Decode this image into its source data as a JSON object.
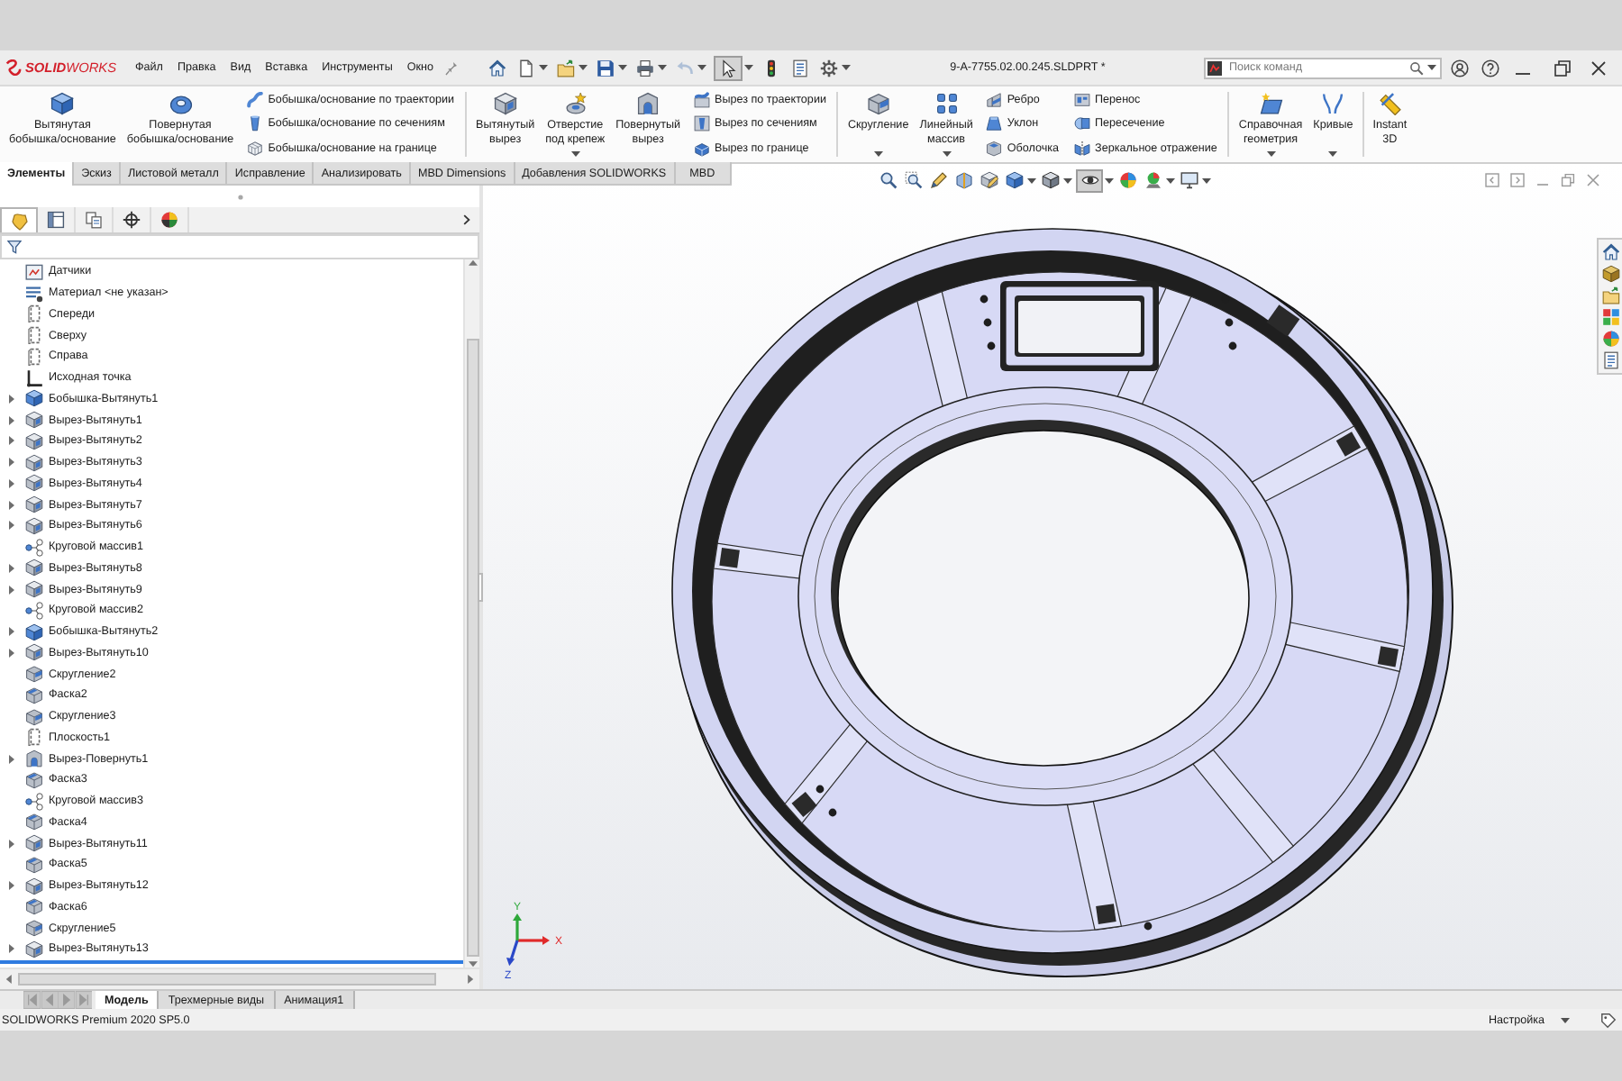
{
  "window": {
    "logo": "**SOLID**WORKS",
    "title": "9-A-7755.02.00.245.SLDPRT *"
  },
  "menu": [
    "Файл",
    "Правка",
    "Вид",
    "Вставка",
    "Инструменты",
    "Окно"
  ],
  "quick_access": [
    {
      "dropdown": false,
      "disabled": false,
      "pressed": false
    },
    {
      "dropdown": true,
      "disabled": false,
      "pressed": false
    },
    {
      "dropdown": true,
      "disabled": false,
      "pressed": false
    },
    {
      "dropdown": true,
      "disabled": false,
      "pressed": false
    },
    {
      "dropdown": true,
      "disabled": false,
      "pressed": false
    },
    {
      "dropdown": true,
      "disabled": true,
      "pressed": false
    },
    {
      "dropdown": true,
      "disabled": false,
      "pressed": true
    },
    {
      "dropdown": false,
      "disabled": false,
      "pressed": false
    },
    {
      "dropdown": false,
      "disabled": false,
      "pressed": false
    },
    {
      "dropdown": true,
      "disabled": false,
      "pressed": false
    }
  ],
  "search": {
    "placeholder": "Поиск команд"
  },
  "ribbon": {
    "groups": [
      [
        {
          "kind": "large",
          "label": "Вытянутая\nбобышка/основание",
          "dropdown": false
        },
        {
          "kind": "large",
          "label": "Повернутая\nбобышка/основание",
          "dropdown": false
        },
        {
          "kind": "stack",
          "items": [
            "Бобышка/основание по траектории",
            "Бобышка/основание по сечениям",
            "Бобышка/основание на границе"
          ]
        }
      ],
      [
        {
          "kind": "large",
          "label": "Вытянутый\nвырез",
          "dropdown": false
        },
        {
          "kind": "large",
          "label": "Отверстие\nпод крепеж",
          "dropdown": true
        },
        {
          "kind": "large",
          "label": "Повернутый\nвырез",
          "dropdown": false
        },
        {
          "kind": "stack",
          "items": [
            "Вырез по траектории",
            "Вырез по сечениям",
            "Вырез по границе"
          ]
        }
      ],
      [
        {
          "kind": "large",
          "label": "Скругление",
          "dropdown": true
        },
        {
          "kind": "large",
          "label": "Линейный\nмассив",
          "dropdown": true
        },
        {
          "kind": "stack",
          "items": [
            "Ребро",
            "Уклон",
            "Оболочка"
          ]
        },
        {
          "kind": "stack",
          "items": [
            "Перенос",
            "Пересечение",
            "Зеркальное отражение"
          ]
        }
      ],
      [
        {
          "kind": "large",
          "label": "Справочная\nгеометрия",
          "dropdown": true
        },
        {
          "kind": "large",
          "label": "Кривые",
          "dropdown": true
        }
      ],
      [
        {
          "kind": "large",
          "label": "Instant\n3D",
          "dropdown": false
        }
      ]
    ]
  },
  "command_tabs": [
    {
      "label": "Элементы",
      "selected": true
    },
    {
      "label": "Эскиз",
      "selected": false
    },
    {
      "label": "Листовой металл",
      "selected": false
    },
    {
      "label": "Исправление",
      "selected": false
    },
    {
      "label": "Анализировать",
      "selected": false
    },
    {
      "label": "MBD Dimensions",
      "selected": false
    },
    {
      "label": "Добавления SOLIDWORKS",
      "selected": false
    },
    {
      "label": "MBD",
      "selected": false
    }
  ],
  "panel_tabs": [
    {
      "selected": true
    },
    {
      "selected": false
    },
    {
      "selected": false
    },
    {
      "selected": false
    },
    {
      "selected": false
    }
  ],
  "feature_tree": {
    "items": [
      {
        "kind": "sensors",
        "label": "Датчики",
        "expandable": false
      },
      {
        "kind": "material",
        "label": "Материал <не указан>",
        "expandable": false
      },
      {
        "kind": "plane",
        "label": "Спереди",
        "expandable": false
      },
      {
        "kind": "plane",
        "label": "Сверху",
        "expandable": false
      },
      {
        "kind": "plane",
        "label": "Справа",
        "expandable": false
      },
      {
        "kind": "origin",
        "label": "Исходная точка",
        "expandable": false
      },
      {
        "kind": "boss",
        "label": "Бобышка-Вытянуть1",
        "expandable": true
      },
      {
        "kind": "cut",
        "label": "Вырез-Вытянуть1",
        "expandable": true
      },
      {
        "kind": "cut",
        "label": "Вырез-Вытянуть2",
        "expandable": true
      },
      {
        "kind": "cut",
        "label": "Вырез-Вытянуть3",
        "expandable": true
      },
      {
        "kind": "cut",
        "label": "Вырез-Вытянуть4",
        "expandable": true
      },
      {
        "kind": "cut",
        "label": "Вырез-Вытянуть7",
        "expandable": true
      },
      {
        "kind": "cut",
        "label": "Вырез-Вытянуть6",
        "expandable": true
      },
      {
        "kind": "pattern",
        "label": "Круговой массив1",
        "expandable": false
      },
      {
        "kind": "cut",
        "label": "Вырез-Вытянуть8",
        "expandable": true
      },
      {
        "kind": "cut",
        "label": "Вырез-Вытянуть9",
        "expandable": true
      },
      {
        "kind": "pattern",
        "label": "Круговой массив2",
        "expandable": false
      },
      {
        "kind": "boss",
        "label": "Бобышка-Вытянуть2",
        "expandable": true
      },
      {
        "kind": "cut",
        "label": "Вырез-Вытянуть10",
        "expandable": true
      },
      {
        "kind": "fillet",
        "label": "Скругление2",
        "expandable": false
      },
      {
        "kind": "chamfer",
        "label": "Фаска2",
        "expandable": false
      },
      {
        "kind": "fillet",
        "label": "Скругление3",
        "expandable": false
      },
      {
        "kind": "plane",
        "label": "Плоскость1",
        "expandable": false
      },
      {
        "kind": "revolve",
        "label": "Вырез-Повернуть1",
        "expandable": true
      },
      {
        "kind": "chamfer",
        "label": "Фаска3",
        "expandable": false
      },
      {
        "kind": "pattern",
        "label": "Круговой массив3",
        "expandable": false
      },
      {
        "kind": "chamfer",
        "label": "Фаска4",
        "expandable": false
      },
      {
        "kind": "cut",
        "label": "Вырез-Вытянуть11",
        "expandable": true
      },
      {
        "kind": "chamfer",
        "label": "Фаска5",
        "expandable": false
      },
      {
        "kind": "cut",
        "label": "Вырез-Вытянуть12",
        "expandable": true
      },
      {
        "kind": "chamfer",
        "label": "Фаска6",
        "expandable": false
      },
      {
        "kind": "fillet",
        "label": "Скругление5",
        "expandable": false
      },
      {
        "kind": "cut",
        "label": "Вырез-Вытянуть13",
        "expandable": true
      }
    ]
  },
  "view_toolbar": [
    {
      "dropdown": false,
      "pressed": false
    },
    {
      "dropdown": false,
      "pressed": false
    },
    {
      "dropdown": false,
      "pressed": false
    },
    {
      "dropdown": false,
      "pressed": false
    },
    {
      "dropdown": false,
      "pressed": false
    },
    {
      "dropdown": true,
      "pressed": false
    },
    {
      "dropdown": true,
      "pressed": false
    },
    {
      "dropdown": true,
      "pressed": true
    },
    {
      "dropdown": false,
      "pressed": false
    },
    {
      "dropdown": true,
      "pressed": false
    },
    {
      "dropdown": true,
      "pressed": false
    }
  ],
  "triad": [
    {
      "label": "X",
      "color": "#e02a2a"
    },
    {
      "label": "Y",
      "color": "#2ea83a"
    },
    {
      "label": "Z",
      "color": "#2a48c8"
    }
  ],
  "sheet_tabs": [
    {
      "label": "Модель",
      "selected": true
    },
    {
      "label": "Трехмерные виды",
      "selected": false
    },
    {
      "label": "Анимация1",
      "selected": false
    }
  ],
  "status_bar": {
    "text": "SOLIDWORKS Premium 2020 SP5.0",
    "menu": "Настройка"
  }
}
